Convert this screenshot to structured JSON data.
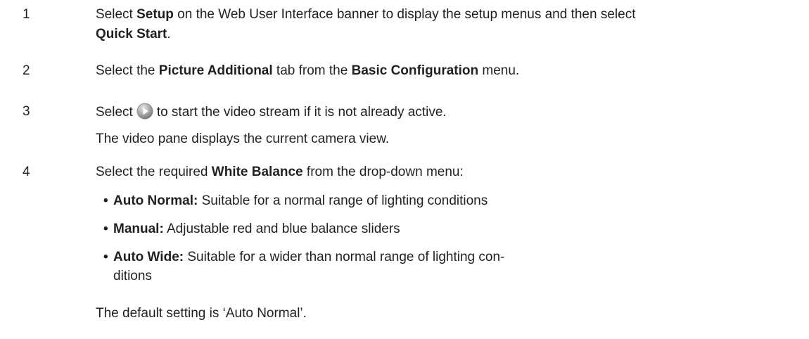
{
  "steps": [
    {
      "number": "1",
      "line1": {
        "pre": "Select ",
        "bold1": "Setup",
        "mid": " on the Web User Interface banner to display the setup menus and then select"
      },
      "line2": {
        "bold": "Quick Start",
        "post": "."
      }
    },
    {
      "number": "2",
      "pre": "Select the ",
      "bold1": "Picture Additional",
      "mid": " tab from the ",
      "bold2": "Basic Configuration",
      "post": " menu."
    },
    {
      "number": "3",
      "pre": "Select",
      "icon": "play-icon",
      "post": "to start the video stream if it is not already active.",
      "note": "The video pane displays the current camera view."
    },
    {
      "number": "4",
      "pre": "Select the required ",
      "bold1": "White Balance",
      "post": " from the drop-down menu:",
      "bullet_char": "•",
      "options": [
        {
          "label": "Auto Normal:",
          "desc": " Suitable for a normal range of lighting conditions"
        },
        {
          "label": "Manual:",
          "desc": " Adjustable red and blue balance sliders"
        },
        {
          "label": "Auto Wide:",
          "desc": " Suitable for a wider than normal range of lighting con-",
          "desc2": "ditions"
        }
      ],
      "note": "The default setting is ‘Auto Normal’."
    }
  ]
}
